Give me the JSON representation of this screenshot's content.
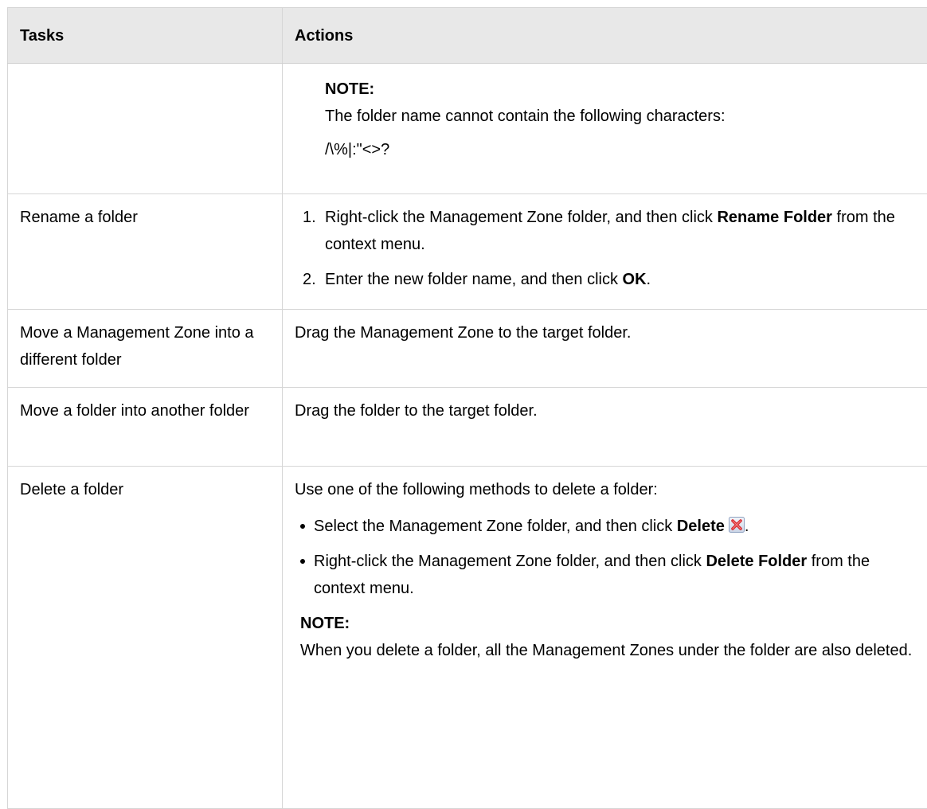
{
  "table": {
    "headers": {
      "tasks": "Tasks",
      "actions": "Actions"
    },
    "row0": {
      "note_title": "NOTE:",
      "note_text": "The folder name cannot contain the following characters:",
      "note_chars": "/\\%|:\"<>?"
    },
    "row1": {
      "task": "Rename a folder",
      "steps": [
        {
          "num": "1.",
          "pre": "Right-click the Management Zone folder, and then click ",
          "bold": "Rename Folder",
          "post": " from the context menu."
        },
        {
          "num": "2.",
          "pre": "Enter the new folder name, and then click ",
          "bold": "OK",
          "post": "."
        }
      ]
    },
    "row2": {
      "task": "Move a Management Zone into a different folder",
      "action": "Drag the Management Zone to the target folder."
    },
    "row3": {
      "task": "Move a folder into another folder",
      "action": "Drag the folder to the target folder."
    },
    "row4": {
      "task": "Delete a folder",
      "intro": "Use one of the following methods to delete a folder:",
      "bullets": [
        {
          "pre": "Select the Management Zone folder, and then click ",
          "bold": "Delete",
          "post": ".",
          "icon": "delete-icon"
        },
        {
          "pre": "Right-click the Management Zone folder, and then click ",
          "bold": "Delete Folder",
          "post": " from the context menu."
        }
      ],
      "note_title": "NOTE:",
      "note_text": "When you delete a folder, all the Management Zones under the folder are also deleted."
    }
  },
  "colors": {
    "header_bg": "#e8e8e8",
    "border": "#d6d6d6",
    "delete_icon_red": "#d9282e"
  }
}
